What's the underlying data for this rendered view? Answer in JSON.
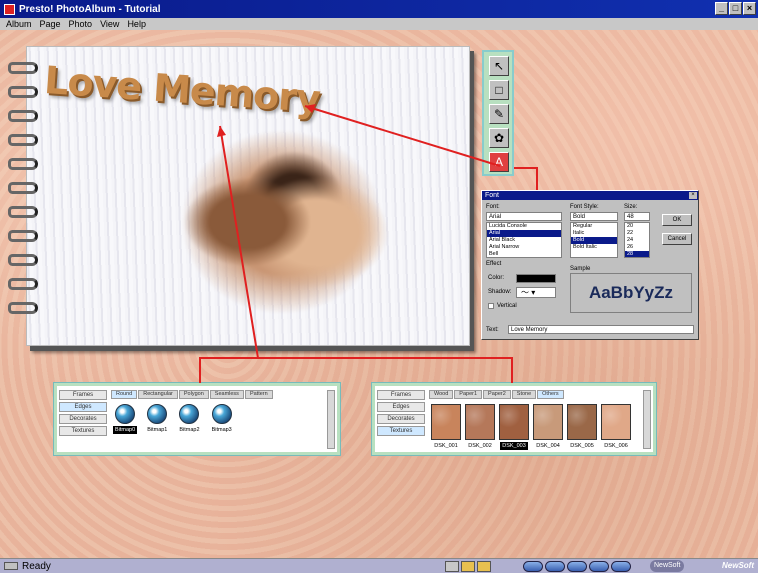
{
  "window": {
    "title": "Presto! PhotoAlbum - Tutorial",
    "buttons": [
      "_",
      "□",
      "×"
    ]
  },
  "menu": [
    "Album",
    "Page",
    "Photo",
    "View",
    "Help"
  ],
  "album": {
    "title_art": "Love Memory"
  },
  "palette": {
    "tools": [
      "pointer-tool",
      "frame-tool",
      "brush-tool",
      "stamp-tool",
      "text-tool"
    ],
    "active": "text-tool",
    "glyphs": [
      "↖",
      "□",
      "✎",
      "✿",
      "A"
    ]
  },
  "font_dialog": {
    "title": "Font",
    "font_label": "Font:",
    "font_value": "Arial",
    "fonts": [
      "Lucida Console",
      "Arial",
      "Arial Black",
      "Arial Narrow",
      "Bell"
    ],
    "style_label": "Font Style:",
    "style_value": "Bold",
    "styles": [
      "Regular",
      "Italic",
      "Bold",
      "Bold Italic"
    ],
    "size_label": "Size:",
    "size_value": "48",
    "sizes": [
      "20",
      "22",
      "24",
      "26",
      "28"
    ],
    "ok": "OK",
    "cancel": "Cancel",
    "effect_label": "Effect",
    "color_label": "Color:",
    "shadow_label": "Shadow:",
    "vertical_label": "Vertical",
    "sample_label": "Sample",
    "sample_text": "AaBbYyZz",
    "text_label": "Text:",
    "text_value": "Love Memory"
  },
  "panel_left": {
    "side": [
      "Frames",
      "Edges",
      "Decorates",
      "Textures"
    ],
    "side_active": 1,
    "tabs": [
      "Round",
      "Rectangular",
      "Polygon",
      "Seamless",
      "Pattern"
    ],
    "tab_active": 0,
    "items": [
      "Bitmap0",
      "Bitmap1",
      "Bitmap2",
      "Bitmap3"
    ],
    "item_selected": 0
  },
  "panel_right": {
    "side": [
      "Frames",
      "Edges",
      "Decorates",
      "Textures"
    ],
    "side_active": 3,
    "tabs": [
      "Wood",
      "Paper1",
      "Paper2",
      "Stone",
      "Others"
    ],
    "tab_active": 4,
    "items": [
      "DSK_001",
      "DSK_002",
      "DSK_003",
      "DSK_004",
      "DSK_005",
      "DSK_006"
    ],
    "item_selected": 2,
    "colors": [
      "#c8845c",
      "#b5785a",
      "#a06040",
      "#c89a7a",
      "#9a6848",
      "#e0a888"
    ]
  },
  "status": {
    "text": "Ready",
    "brand_pill": "NewSoft",
    "brand_logo": "NewSoft"
  }
}
